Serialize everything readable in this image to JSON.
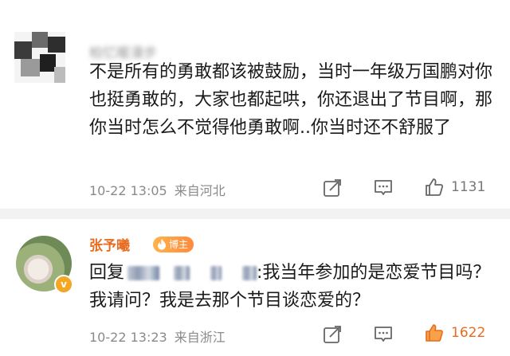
{
  "comments": [
    {
      "username": "柏忆暖漫步",
      "text": "不是所有的勇敢都该被鼓励，当时一年级万国鹏对你也挺勇敢的，大家也都起哄，你还退出了节目啊，那你当时怎么不觉得他勇敢啊..你当时还不舒服了",
      "time": "10-22 13:05",
      "location": "来自河北",
      "likes": "1131",
      "liked": false
    },
    {
      "username": "张予曦",
      "badge": "博主",
      "reply_prefix": "回复",
      "text": ":我当年参加的是恋爱节目吗？我请问？我是去那个节目谈恋爱的？",
      "time": "10-22 13:23",
      "location": "来自浙江",
      "likes": "1622",
      "liked": true
    }
  ],
  "icons": {
    "share": "share-icon",
    "comment": "comment-icon",
    "like": "like-icon",
    "verified": "verified-v-icon"
  },
  "colors": {
    "accent": "#e86b1f",
    "meta": "#8a8a8a",
    "divider": "#f2f2f2"
  }
}
